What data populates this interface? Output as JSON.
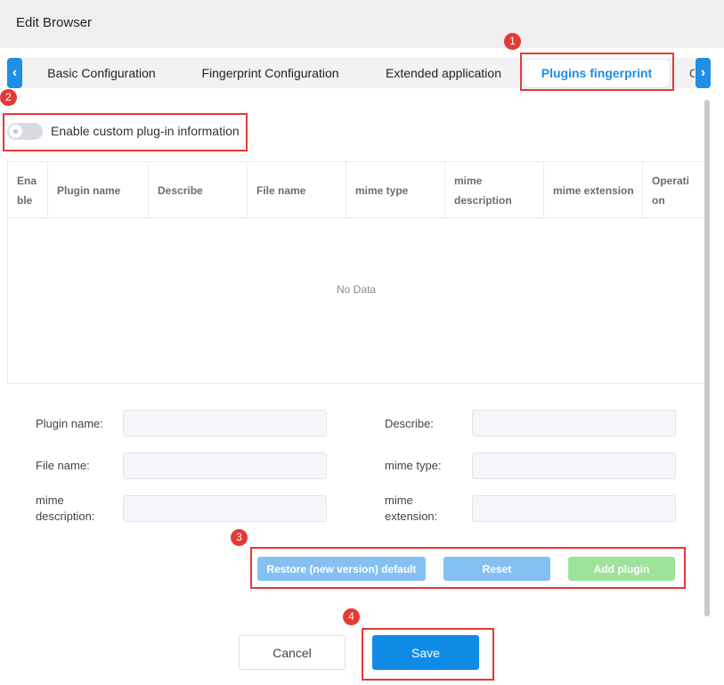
{
  "window": {
    "title": "Edit Browser"
  },
  "tabs": {
    "items": [
      {
        "label": "Basic Configuration"
      },
      {
        "label": "Fingerprint Configuration"
      },
      {
        "label": "Extended application"
      },
      {
        "label": "Plugins fingerprint"
      }
    ],
    "overflow_label": "C",
    "prev_icon": "‹",
    "next_icon": "›"
  },
  "toggle": {
    "label": "Enable custom plug-in information",
    "state": "off"
  },
  "table": {
    "columns": [
      "Ena ble",
      "Plugin name",
      "Describe",
      "File name",
      "mime type",
      "mime description",
      "mime extension",
      "Operati on"
    ],
    "empty_text": "No Data"
  },
  "form": {
    "plugin_name": "Plugin name:",
    "describe": "Describe:",
    "file_name": "File name:",
    "mime_type": "mime type:",
    "mime_description": "mime description:",
    "mime_extension": "mime extension:"
  },
  "actions": {
    "restore": "Restore (new version) default",
    "reset": "Reset",
    "add_plugin": "Add plugin"
  },
  "footer": {
    "cancel": "Cancel",
    "save": "Save"
  },
  "annotations": [
    "1",
    "2",
    "3",
    "4"
  ],
  "colors": {
    "accent": "#1e8ee6",
    "highlight": "#e53935",
    "save": "#0f8be6",
    "add": "#9de39b"
  }
}
